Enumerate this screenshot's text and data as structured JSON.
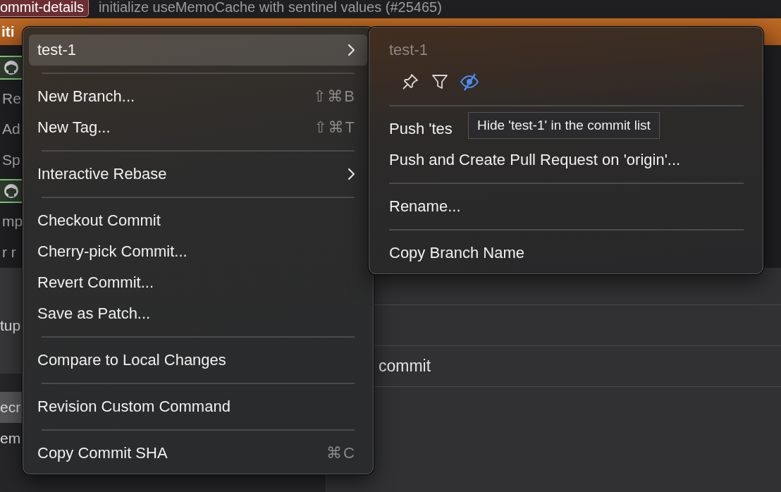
{
  "header": {
    "badge": "ommit-details",
    "title": "initialize useMemoCache with sentinel values (#25465)"
  },
  "banner": {
    "text": "iti"
  },
  "commit_list_fragments": [
    {
      "kind": "icon-chip"
    },
    {
      "kind": "text",
      "text": "Re"
    },
    {
      "kind": "text",
      "text": "Ad"
    },
    {
      "kind": "text",
      "text": "Sp"
    },
    {
      "kind": "icon-chip"
    },
    {
      "kind": "text",
      "text": "mp"
    },
    {
      "kind": "text",
      "text": "r r"
    }
  ],
  "lower_left_fragments": [
    {
      "text": "tup",
      "selected": false
    },
    {
      "text": "ecr",
      "selected": true
    },
    {
      "text": "em",
      "selected": false
    }
  ],
  "detail_panel": {
    "rows": [
      "",
      "commit",
      ""
    ]
  },
  "context_menu": {
    "groups": [
      [
        {
          "label": "test-1",
          "submenu": true,
          "selected": true
        }
      ],
      [
        {
          "label": "New Branch...",
          "shortcut": "⇧⌘B",
          "submenu": false,
          "selected": false
        },
        {
          "label": "New Tag...",
          "shortcut": "⇧⌘T",
          "submenu": false,
          "selected": false
        }
      ],
      [
        {
          "label": "Interactive Rebase",
          "submenu": true,
          "selected": false
        }
      ],
      [
        {
          "label": "Checkout Commit",
          "submenu": false,
          "selected": false
        },
        {
          "label": "Cherry-pick Commit...",
          "submenu": false,
          "selected": false
        },
        {
          "label": "Revert Commit...",
          "submenu": false,
          "selected": false
        },
        {
          "label": "Save as Patch...",
          "submenu": false,
          "selected": false
        }
      ],
      [
        {
          "label": "Compare to Local Changes",
          "submenu": false,
          "selected": false
        }
      ],
      [
        {
          "label": "Revision Custom Command",
          "submenu": false,
          "selected": false
        }
      ],
      [
        {
          "label": "Copy Commit SHA",
          "shortcut": "⌘C",
          "submenu": false,
          "selected": false
        }
      ]
    ]
  },
  "submenu": {
    "title": "test-1",
    "actions": [
      {
        "kind": "pin",
        "active": false
      },
      {
        "kind": "filter",
        "active": false
      },
      {
        "kind": "hide",
        "active": true
      }
    ],
    "groups": [
      [
        "Push 'tes",
        "Push and Create Pull Request on 'origin'..."
      ],
      [
        "Rename..."
      ],
      [
        "Copy Branch Name"
      ]
    ],
    "tooltip": "Hide 'test-1' in the commit list"
  }
}
